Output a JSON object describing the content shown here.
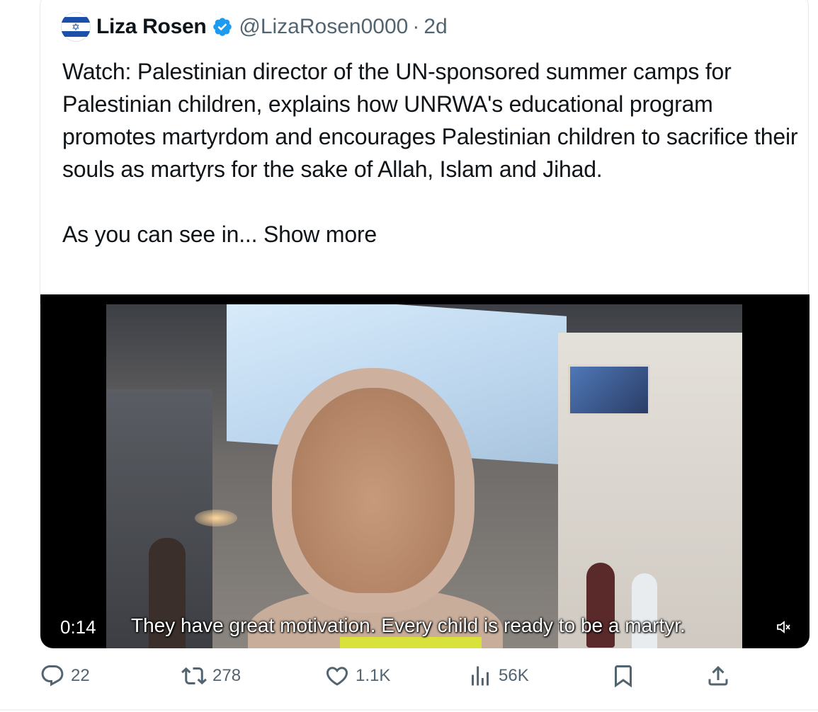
{
  "author": {
    "name": "Liza Rosen",
    "handle": "@LizaRosen0000",
    "separator": "·",
    "time": "2d",
    "verified": true,
    "avatar_icon": "israel-flag-avatar"
  },
  "tweet": {
    "text_line1": "Watch: Palestinian director of the UN-sponsored summer camps for Palestinian children, explains how UNRWA's educational program promotes martyrdom and encourages Palestinian children to sacrifice their souls as martyrs for the sake of Allah, Islam and Jihad.",
    "text_line2_prefix": "As you can see in... ",
    "show_more": "Show more"
  },
  "video": {
    "time": "0:14",
    "subtitle": "They have great motivation. Every child is ready to be a martyr.",
    "mute_icon": "speaker-muted-icon"
  },
  "actions": {
    "replies": "22",
    "reposts": "278",
    "likes": "1.1K",
    "views": "56K",
    "reply_icon": "reply-icon",
    "repost_icon": "repost-icon",
    "like_icon": "heart-icon",
    "views_icon": "views-icon",
    "bookmark_icon": "bookmark-icon",
    "share_icon": "share-icon"
  },
  "colors": {
    "text": "#0f1419",
    "secondary": "#536471",
    "verified": "#1d9bf0"
  }
}
